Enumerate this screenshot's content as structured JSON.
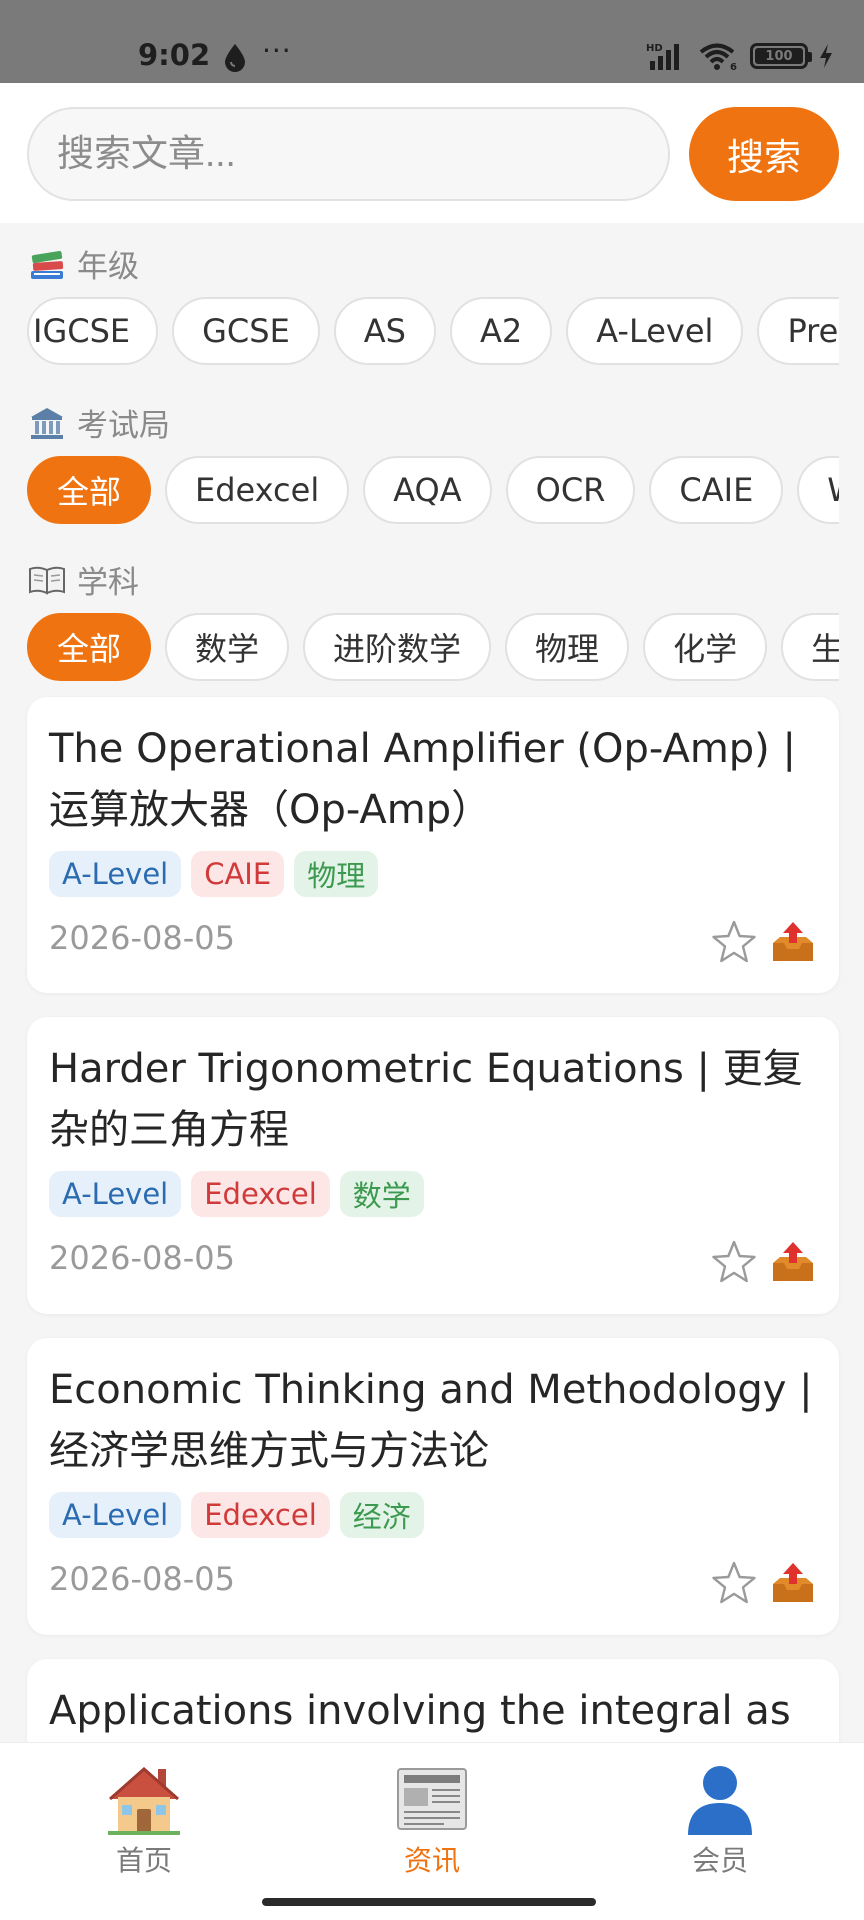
{
  "status_bar": {
    "time": "9:02",
    "dots": "···",
    "battery": "100"
  },
  "search": {
    "placeholder": "搜索文章...",
    "button_label": "搜索"
  },
  "filters": {
    "grade": {
      "label": "年级",
      "options": [
        "IGCSE",
        "GCSE",
        "AS",
        "A2",
        "A-Level",
        "Pre-U"
      ]
    },
    "board": {
      "label": "考试局",
      "options": [
        "全部",
        "Edexcel",
        "AQA",
        "OCR",
        "CAIE",
        "WJ"
      ]
    },
    "subject": {
      "label": "学科",
      "options": [
        "全部",
        "数学",
        "进阶数学",
        "物理",
        "化学",
        "生"
      ]
    }
  },
  "articles": [
    {
      "title": "The Operational Amplifier (Op-Amp) | 运算放大器（Op-Amp）",
      "tags": [
        "A-Level",
        "CAIE",
        "物理"
      ],
      "date": "2026-08-05"
    },
    {
      "title": "Harder Trigonometric Equations | 更复杂的三角方程",
      "tags": [
        "A-Level",
        "Edexcel",
        "数学"
      ],
      "date": "2026-08-05"
    },
    {
      "title": "Economic Thinking and Methodology | 经济学思维方式与方法论",
      "tags": [
        "A-Level",
        "Edexcel",
        "经济"
      ],
      "date": "2026-08-05"
    },
    {
      "title": "Applications involving the integral as"
    }
  ],
  "nav": {
    "items": [
      {
        "label": "首页"
      },
      {
        "label": "资讯"
      },
      {
        "label": "会员"
      }
    ]
  },
  "colors": {
    "accent": "#ef7411",
    "tag_level": "#2b6cb0",
    "tag_board": "#d03a3a",
    "tag_subject": "#3b9a4f"
  }
}
